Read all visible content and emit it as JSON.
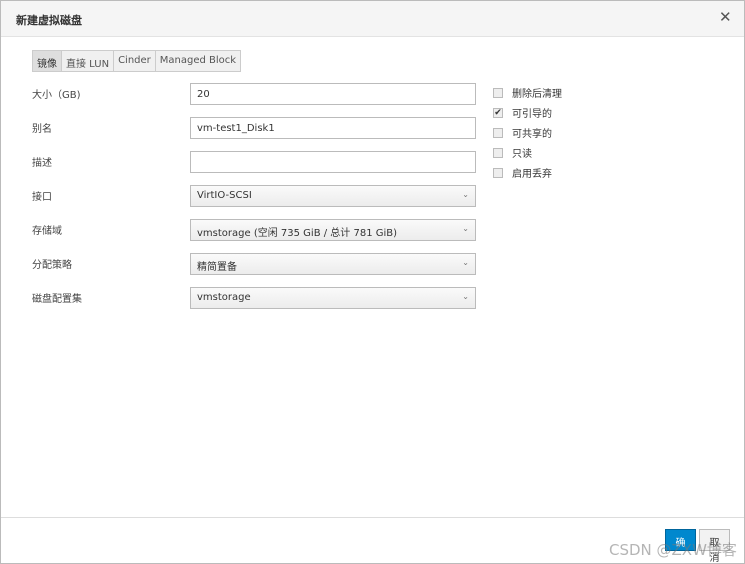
{
  "dialog": {
    "title": "新建虚拟磁盘",
    "close_icon": "close-icon"
  },
  "tabs": [
    {
      "label": "镜像",
      "active": true
    },
    {
      "label": "直接 LUN"
    },
    {
      "label": "Cinder"
    },
    {
      "label": "Managed Block"
    }
  ],
  "fields": {
    "size": {
      "label": "大小（GB)",
      "value": "20"
    },
    "alias": {
      "label": "别名",
      "value": "vm-test1_Disk1"
    },
    "description": {
      "label": "描述",
      "value": ""
    },
    "interface": {
      "label": "接口",
      "value": "VirtIO-SCSI"
    },
    "storage_domain": {
      "label": "存储域",
      "value": "vmstorage (空闲 735 GiB / 总计 781 GiB)"
    },
    "allocation_policy": {
      "label": "分配策略",
      "value": "精简置备"
    },
    "disk_profile": {
      "label": "磁盘配置集",
      "value": "vmstorage"
    }
  },
  "checkboxes": [
    {
      "label": "删除后清理",
      "checked": false
    },
    {
      "label": "可引导的",
      "checked": true
    },
    {
      "label": "可共享的",
      "checked": false
    },
    {
      "label": "只读",
      "checked": false
    },
    {
      "label": "启用丢弃",
      "checked": false
    }
  ],
  "footer": {
    "ok_label": "确定",
    "cancel_label": "取消"
  },
  "watermark": "CSDN @ZXW博客"
}
